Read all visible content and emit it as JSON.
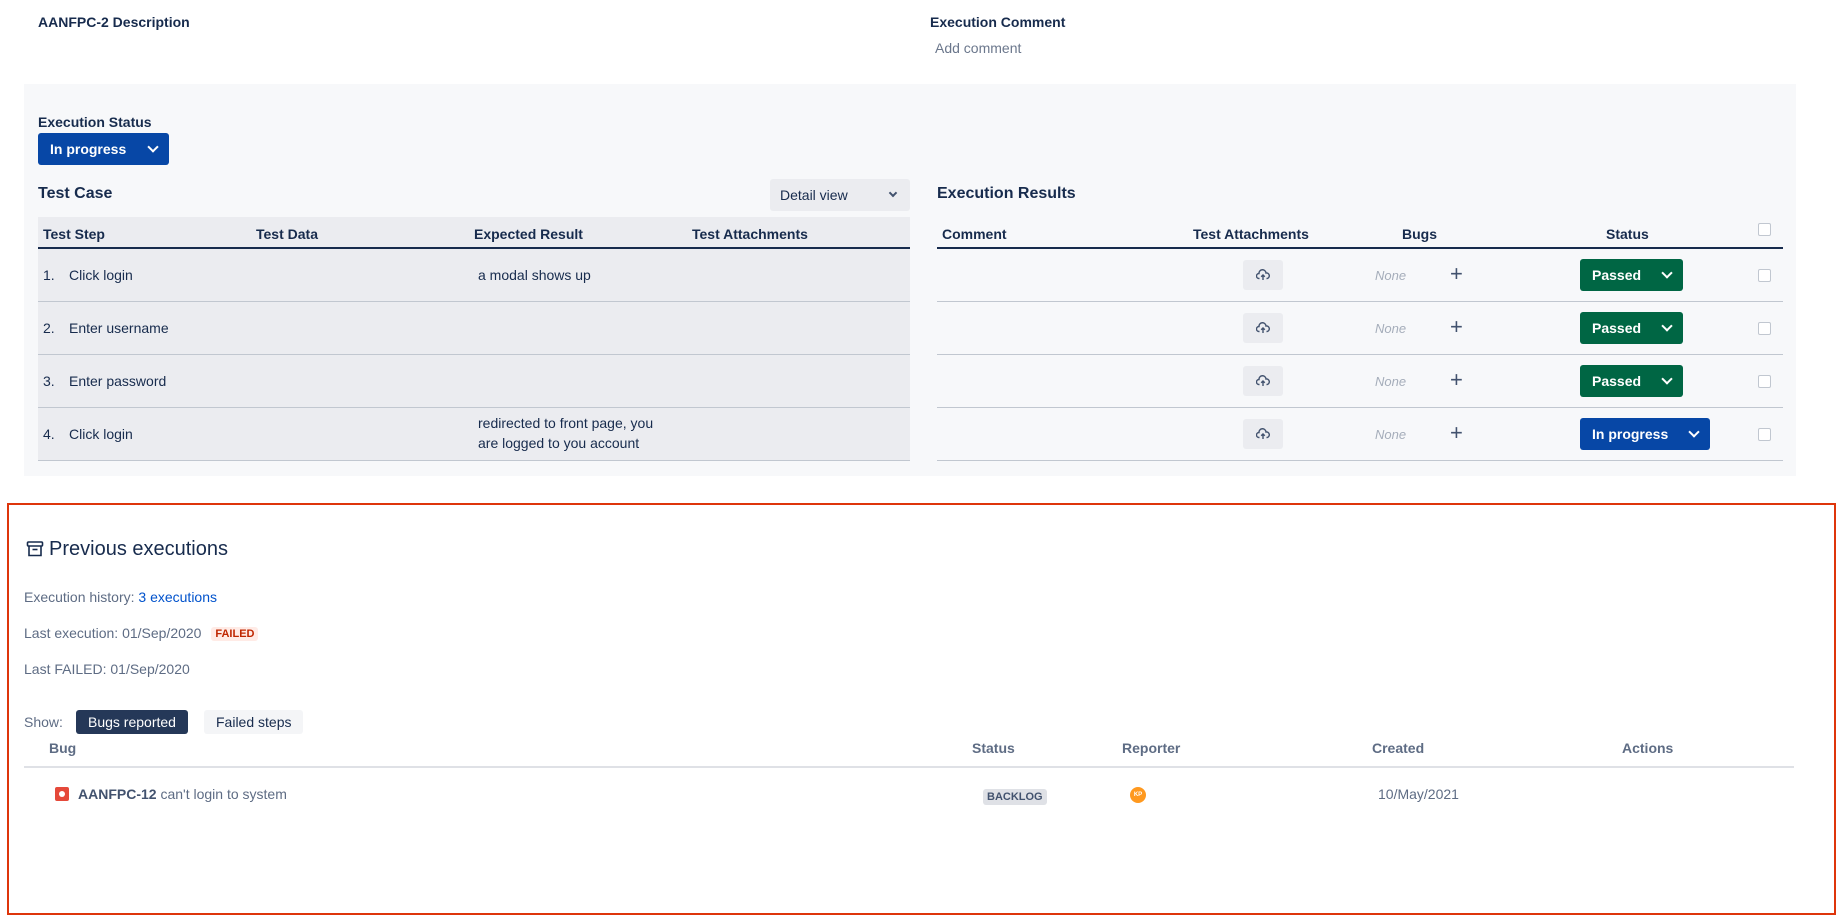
{
  "header": {
    "description_label": "AANFPC-2 Description",
    "comment_label": "Execution Comment",
    "add_comment": "Add comment"
  },
  "execution": {
    "status_label": "Execution Status",
    "status_value": "In progress"
  },
  "test_case": {
    "title": "Test Case",
    "view_select": "Detail view",
    "columns": [
      "Test Step",
      "Test Data",
      "Expected Result",
      "Test Attachments"
    ],
    "rows": [
      {
        "num": "1.",
        "step": "Click login",
        "expected": "a modal shows up"
      },
      {
        "num": "2.",
        "step": "Enter username",
        "expected": ""
      },
      {
        "num": "3.",
        "step": "Enter password",
        "expected": ""
      },
      {
        "num": "4.",
        "step": "Click login",
        "expected_line1": "redirected to front page, you",
        "expected_line2": "are logged to you account"
      }
    ]
  },
  "results": {
    "title": "Execution Results",
    "columns": [
      "Comment",
      "Test Attachments",
      "Bugs",
      "Status"
    ],
    "rows": [
      {
        "bugs": "None",
        "status": "Passed",
        "status_color": "#006644"
      },
      {
        "bugs": "None",
        "status": "Passed",
        "status_color": "#006644"
      },
      {
        "bugs": "None",
        "status": "Passed",
        "status_color": "#006644"
      },
      {
        "bugs": "None",
        "status": "In progress",
        "status_color": "#0747a6"
      }
    ]
  },
  "previous": {
    "title": "Previous executions",
    "icon": "archive-icon",
    "history_label": "Execution history:",
    "history_link": "3 executions",
    "last_exec_label": "Last execution:",
    "last_exec_date": "01/Sep/2020",
    "last_exec_status": "FAILED",
    "last_failed_label": "Last FAILED:",
    "last_failed_date": "01/Sep/2020",
    "show_label": "Show:",
    "toggle_bugs": "Bugs reported",
    "toggle_failed": "Failed steps",
    "bug_columns": [
      "Bug",
      "Status",
      "Reporter",
      "Created",
      "Actions"
    ],
    "bugs": [
      {
        "key": "AANFPC-12",
        "summary": "can't login to system",
        "status": "BACKLOG",
        "reporter_initials": "KP",
        "created": "10/May/2021"
      }
    ]
  },
  "colors": {
    "accent_blue": "#0747a6",
    "passed_green": "#006644",
    "highlight_red": "#de350b",
    "link": "#0052cc"
  }
}
